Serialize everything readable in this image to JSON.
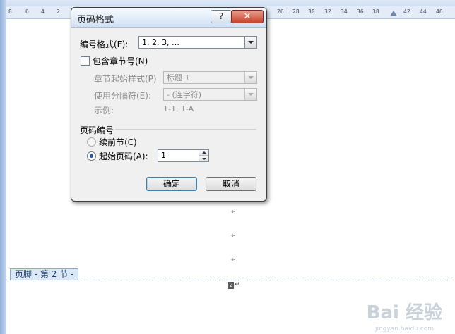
{
  "ruler": {
    "numbers": [
      "8",
      "6",
      "4",
      "2",
      "26",
      "28",
      "30",
      "32",
      "34",
      "36",
      "38",
      "42",
      "44",
      "46"
    ]
  },
  "document": {
    "footer_tab": "页脚 - 第 2 节 -",
    "page_number": "2",
    "para_mark": "↵",
    "watermark": "Bai 经验",
    "watermark_sub": "jingyan.baidu.com"
  },
  "dialog": {
    "title": "页码格式",
    "help_label": "?",
    "close_label": "✕",
    "number_format_label": "编号格式(F):",
    "number_format_value": "1, 2, 3, …",
    "include_chapter_label": "包含章节号(N)",
    "chapter_style_label": "章节起始样式(P)",
    "chapter_style_value": "标题 1",
    "separator_label": "使用分隔符(E):",
    "separator_value": "-    (连字符)",
    "example_label": "示例:",
    "example_value": "1-1, 1-A",
    "page_numbering_label": "页码编号",
    "continue_label": "续前节(C)",
    "start_at_label": "起始页码(A):",
    "start_at_value": "1",
    "ok_label": "确定",
    "cancel_label": "取消"
  },
  "colors": {
    "accent": "#1b4ea0",
    "close_button": "#c8432c"
  }
}
